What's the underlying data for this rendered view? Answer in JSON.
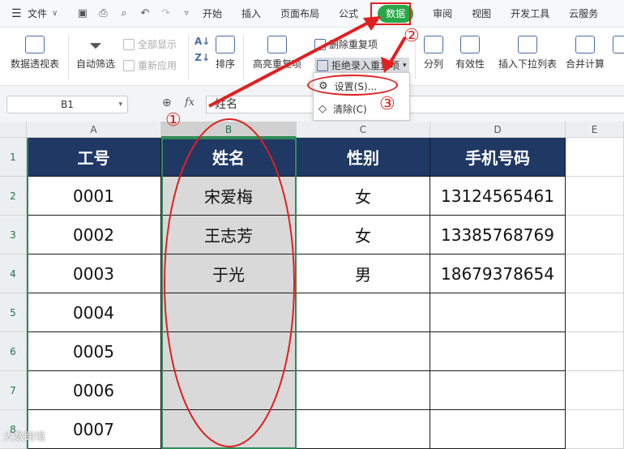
{
  "menubar": {
    "file_label": "文件",
    "tabs": [
      "开始",
      "插入",
      "页面布局",
      "公式",
      "数据",
      "审阅",
      "视图",
      "开发工具",
      "云服务"
    ],
    "active_tab": "数据"
  },
  "ribbon": {
    "pivot": "数据透视表",
    "autofilter": "自动筛选",
    "show_all": "全部显示",
    "reapply": "重新应用",
    "sort": "排序",
    "highlight_dup": "高亮重复项",
    "delete_dup": "删除重复项",
    "reject_dup": "拒绝录入重复项",
    "split": "分列",
    "validity": "有效性",
    "insert_dropdown": "插入下拉列表",
    "merge_calc": "合并计算"
  },
  "dropdown": {
    "settings": "设置(S)...",
    "clear": "清除(C)"
  },
  "formula_bar": {
    "name_box": "B1",
    "fx": "fx",
    "value": "姓名"
  },
  "columns": [
    "A",
    "B",
    "C",
    "D",
    "E"
  ],
  "rows": [
    "1",
    "2",
    "3",
    "4",
    "5",
    "6",
    "7",
    "8"
  ],
  "table": {
    "headers": [
      "工号",
      "姓名",
      "性别",
      "手机号码"
    ],
    "data": [
      [
        "0001",
        "宋爱梅",
        "女",
        "13124565461"
      ],
      [
        "0002",
        "王志芳",
        "女",
        "13385768769"
      ],
      [
        "0003",
        "于光",
        "男",
        "18679378654"
      ],
      [
        "0004",
        "",
        "",
        ""
      ],
      [
        "0005",
        "",
        "",
        ""
      ],
      [
        "0006",
        "",
        "",
        ""
      ],
      [
        "0007",
        "",
        "",
        ""
      ]
    ]
  },
  "annotations": {
    "step1": "①",
    "step2": "②",
    "step3": "③"
  },
  "watermark": "大数跨境",
  "colors": {
    "header_bg": "#1f3864",
    "selection_green": "#2e8b57",
    "annotation_red": "#e02020",
    "tab_active": "#27a745"
  }
}
